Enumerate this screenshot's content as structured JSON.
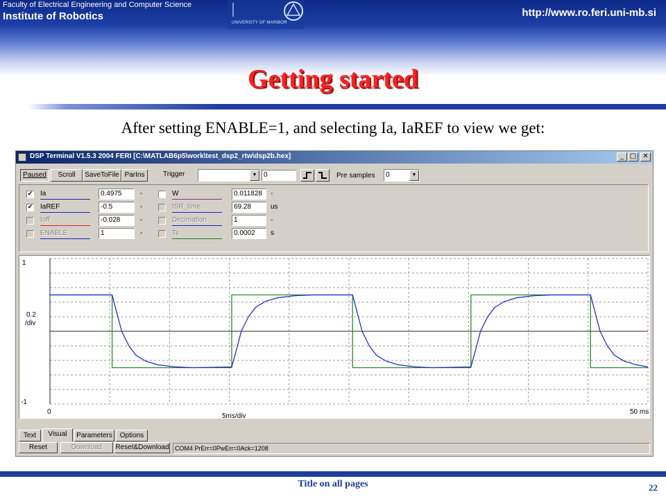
{
  "slide": {
    "faculty": "Faculty of Electrical Engineering and Computer Science",
    "institute": "Institute of Robotics",
    "university": "UNIVERSITY OF MARIBOR",
    "url": "http://www.ro.feri.uni-mb.si",
    "title": "Getting started",
    "subtitle": "After setting ENABLE=1, and selecting Ia, IaREF to view we get:",
    "footer": "Title on all pages",
    "page_number": "22",
    "colors": {
      "header_blue": "#1f3d9e",
      "title_red": "#ff1f1f"
    }
  },
  "window": {
    "title": "DSP Terminal V1.5.3 2004 FERI [C:\\MATLAB6p5\\work\\test_dsp2_rtw\\dsp2b.hex]",
    "controls": {
      "minimize": "_",
      "maximize": "□",
      "close": "✕"
    }
  },
  "toolbar": {
    "paused": "Paused",
    "scroll": "Scroll",
    "save_to_file": "SaveToFile",
    "params": "ParIns",
    "trigger_label": "Trigger",
    "trigger_value": "",
    "trigger_level": "0",
    "pre_samples_label": "Pre samples",
    "pre_samples_value": "0"
  },
  "signals_left": [
    {
      "name": "Ia",
      "checked": true,
      "enabled": true,
      "value": "0.4975",
      "unit": "-",
      "color": "#2020c0"
    },
    {
      "name": "IaREF",
      "checked": true,
      "enabled": true,
      "value": "-0.5",
      "unit": "-",
      "color": "#2020c0"
    },
    {
      "name": "Ioff",
      "checked": false,
      "enabled": false,
      "value": "-0.028",
      "unit": "-",
      "color": "#e02020"
    },
    {
      "name": "ENABLE",
      "checked": false,
      "enabled": false,
      "value": "1",
      "unit": "-",
      "color": "#2020c0"
    }
  ],
  "signals_right": [
    {
      "name": "W",
      "checked": false,
      "enabled": true,
      "value": "0.011828",
      "unit": "-",
      "color": "#a020a0"
    },
    {
      "name": "ISR_time",
      "checked": false,
      "enabled": false,
      "value": "69.28",
      "unit": "us",
      "color": "#2020c0"
    },
    {
      "name": "Decimation",
      "checked": false,
      "enabled": false,
      "value": "1",
      "unit": "-",
      "color": "#2020c0"
    },
    {
      "name": "Ts",
      "checked": false,
      "enabled": false,
      "value": "0.0002",
      "unit": "s",
      "color": "#208020"
    }
  ],
  "scope": {
    "y_top": "1",
    "y_bottom": "-1",
    "y_scale": "0.2",
    "y_scale_unit": "/div",
    "x_start": "0",
    "x_scale": "5ms/div",
    "x_end": "50 ms",
    "grid": true
  },
  "chart_data": {
    "type": "line",
    "xlabel": "5ms/div",
    "ylabel": "0.2 /div",
    "xlim": [
      0,
      50
    ],
    "ylim": [
      -1,
      1
    ],
    "series": [
      {
        "name": "IaREF",
        "color": "#2a8a2a",
        "x": [
          0,
          5.2,
          5.2,
          15.2,
          15.2,
          25.3,
          25.3,
          35.2,
          35.2,
          45.2,
          45.2,
          50
        ],
        "y": [
          0.5,
          0.5,
          -0.5,
          -0.5,
          0.5,
          0.5,
          -0.5,
          -0.5,
          0.5,
          0.5,
          -0.5,
          -0.5
        ]
      },
      {
        "name": "Ia",
        "color": "#2a2ad0",
        "x": [
          0,
          5.2,
          5.6,
          6.0,
          6.6,
          7.2,
          8.0,
          9.0,
          10.5,
          12.0,
          15.2,
          15.6,
          16.0,
          16.6,
          17.2,
          18.0,
          19.0,
          20.5,
          22.0,
          25.3,
          25.7,
          26.1,
          26.7,
          27.3,
          28.1,
          29.1,
          30.6,
          32.0,
          35.2,
          35.6,
          36.0,
          36.6,
          37.2,
          38.0,
          39.0,
          40.5,
          42.0,
          45.2,
          45.6,
          46.0,
          46.6,
          47.2,
          48.0,
          49.0,
          50.0
        ],
        "y": [
          0.5,
          0.5,
          0.25,
          0.0,
          -0.2,
          -0.33,
          -0.41,
          -0.46,
          -0.49,
          -0.5,
          -0.49,
          -0.25,
          0.0,
          0.2,
          0.33,
          0.41,
          0.46,
          0.49,
          0.5,
          0.5,
          0.25,
          0.0,
          -0.2,
          -0.33,
          -0.41,
          -0.46,
          -0.49,
          -0.5,
          -0.49,
          -0.25,
          0.0,
          0.2,
          0.33,
          0.41,
          0.46,
          0.49,
          0.5,
          0.5,
          0.25,
          0.0,
          -0.2,
          -0.33,
          -0.41,
          -0.46,
          -0.49
        ]
      }
    ]
  },
  "tabs": [
    "Text",
    "Visual",
    "Parameters",
    "Options"
  ],
  "active_tab": "Visual",
  "bottom_buttons": {
    "reset": "Reset",
    "download": "Download",
    "reset_download": "Reset&Download"
  },
  "status": "COM4 PrErr=0PwErr=0Ack=1208"
}
